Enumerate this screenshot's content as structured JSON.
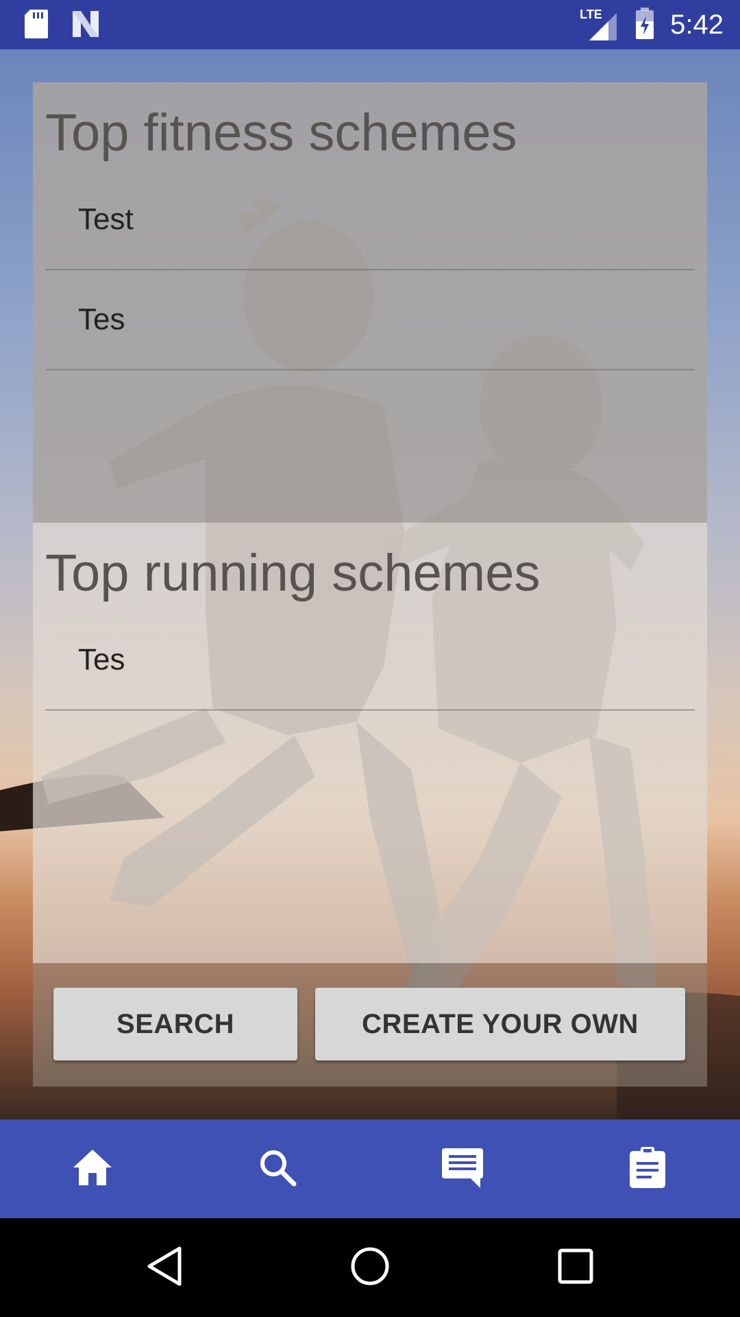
{
  "status_bar": {
    "time": "5:42",
    "network_label": "LTE",
    "icons": [
      "sd-card-icon",
      "n-logo-icon",
      "signal-icon",
      "battery-charging-icon"
    ]
  },
  "sections": [
    {
      "title": "Top fitness schemes",
      "items": [
        "Test",
        "Tes"
      ]
    },
    {
      "title": "Top running schemes",
      "items": [
        "Tes"
      ]
    }
  ],
  "buttons": {
    "search_label": "SEARCH",
    "create_label": "CREATE YOUR OWN"
  },
  "bottom_nav": {
    "icons": [
      "home-icon",
      "search-icon",
      "message-icon",
      "clipboard-icon"
    ]
  },
  "system_nav": {
    "icons": [
      "back-icon",
      "home-circle-icon",
      "recents-icon"
    ]
  },
  "colors": {
    "status_bar": "#303f9f",
    "bottom_nav": "#3f51b5",
    "button_bg": "#d6d8d8"
  }
}
